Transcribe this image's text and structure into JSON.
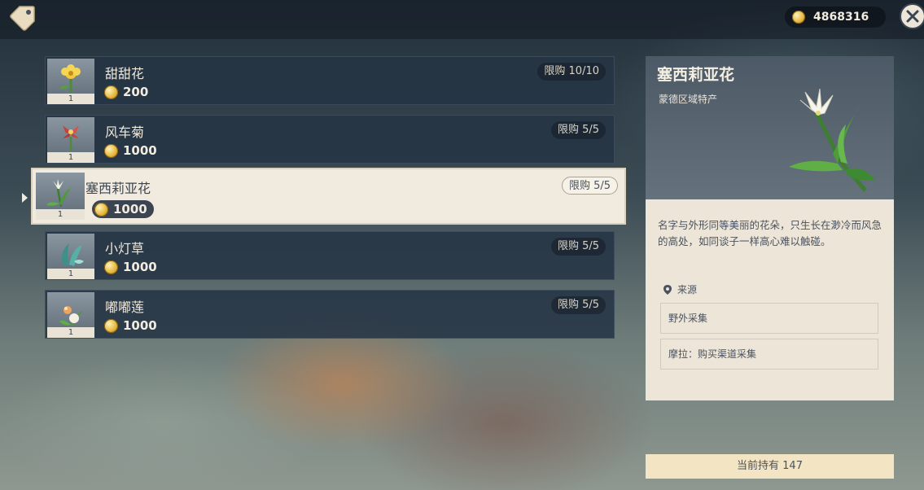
{
  "header": {
    "currency_icon": "mora-coin-icon",
    "currency_value": "4868316",
    "shop_icon": "price-tag-icon",
    "close_icon": "close-icon"
  },
  "items": [
    {
      "name": "甜甜花",
      "price": "200",
      "limit": "限购 10/10",
      "count": "1",
      "icon": "sweet-flower-icon",
      "selected": false
    },
    {
      "name": "风车菊",
      "price": "1000",
      "limit": "限购 5/5",
      "count": "1",
      "icon": "windwheel-aster-icon",
      "selected": false
    },
    {
      "name": "塞西莉亚花",
      "price": "1000",
      "limit": "限购 5/5",
      "count": "1",
      "icon": "cecilia-icon",
      "selected": true
    },
    {
      "name": "小灯草",
      "price": "1000",
      "limit": "限购 5/5",
      "count": "1",
      "icon": "small-lamp-grass-icon",
      "selected": false
    },
    {
      "name": "嘟嘟莲",
      "price": "1000",
      "limit": "限购 5/5",
      "count": "1",
      "icon": "calla-lily-icon",
      "selected": false
    }
  ],
  "detail": {
    "title": "塞西莉亚花",
    "subtitle": "蒙德区域特产",
    "description": "名字与外形同等美丽的花朵，只生长在渺冷而风急的高处，如同谈子一样高心难以触碰。",
    "source_label": "来源",
    "sources": [
      "野外采集",
      "摩拉：购买渠道采集"
    ]
  },
  "holding": "当前持有 147",
  "colors": {
    "panel_dark": "#263444",
    "panel_light": "#ece5d8",
    "accent_gold": "#e6b93f",
    "text_dark": "#3b4552"
  }
}
